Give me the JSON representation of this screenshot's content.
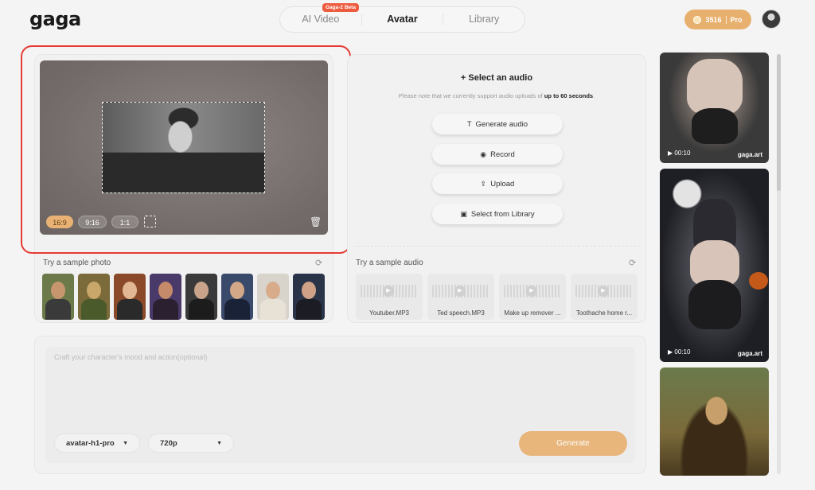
{
  "app": {
    "logo": "gaga"
  },
  "nav": {
    "tabs": [
      {
        "label": "AI Video"
      },
      {
        "label": "Avatar"
      },
      {
        "label": "Library"
      }
    ],
    "beta_badge": "Gaga-2 Beta"
  },
  "account": {
    "credits": "3516",
    "plan": "Pro"
  },
  "upload": {
    "ratios": [
      {
        "label": "16:9"
      },
      {
        "label": "9:16"
      },
      {
        "label": "1:1"
      }
    ],
    "sample_photo_label": "Try a sample photo"
  },
  "audio": {
    "title": "+ Select an audio",
    "note_prefix": "Please note that we currently support audio uploads of ",
    "note_bold": "up to 60 seconds",
    "note_suffix": ".",
    "buttons": [
      {
        "label": "Generate audio",
        "icon": "T"
      },
      {
        "label": "Record",
        "icon": "◉"
      },
      {
        "label": "Upload",
        "icon": "⇪"
      },
      {
        "label": "Select from Library",
        "icon": "▣"
      }
    ],
    "sample_audio_label": "Try a sample audio",
    "samples": [
      {
        "name": "Youtuber.MP3"
      },
      {
        "name": "Ted speech.MP3"
      },
      {
        "name": "Make up remover ..."
      },
      {
        "name": "Toothache home r..."
      }
    ]
  },
  "prompt": {
    "placeholder": "Craft your character's mood and action(optional)",
    "model": "avatar-h1-pro",
    "resolution": "720p",
    "generate_label": "Generate"
  },
  "gallery": [
    {
      "duration": "▶ 00:10",
      "watermark": "gaga.art"
    },
    {
      "duration": "▶ 00:10",
      "watermark": "gaga.art"
    }
  ],
  "colors": {
    "accent": "#e8b06e",
    "highlight_outline": "#e53b34"
  }
}
